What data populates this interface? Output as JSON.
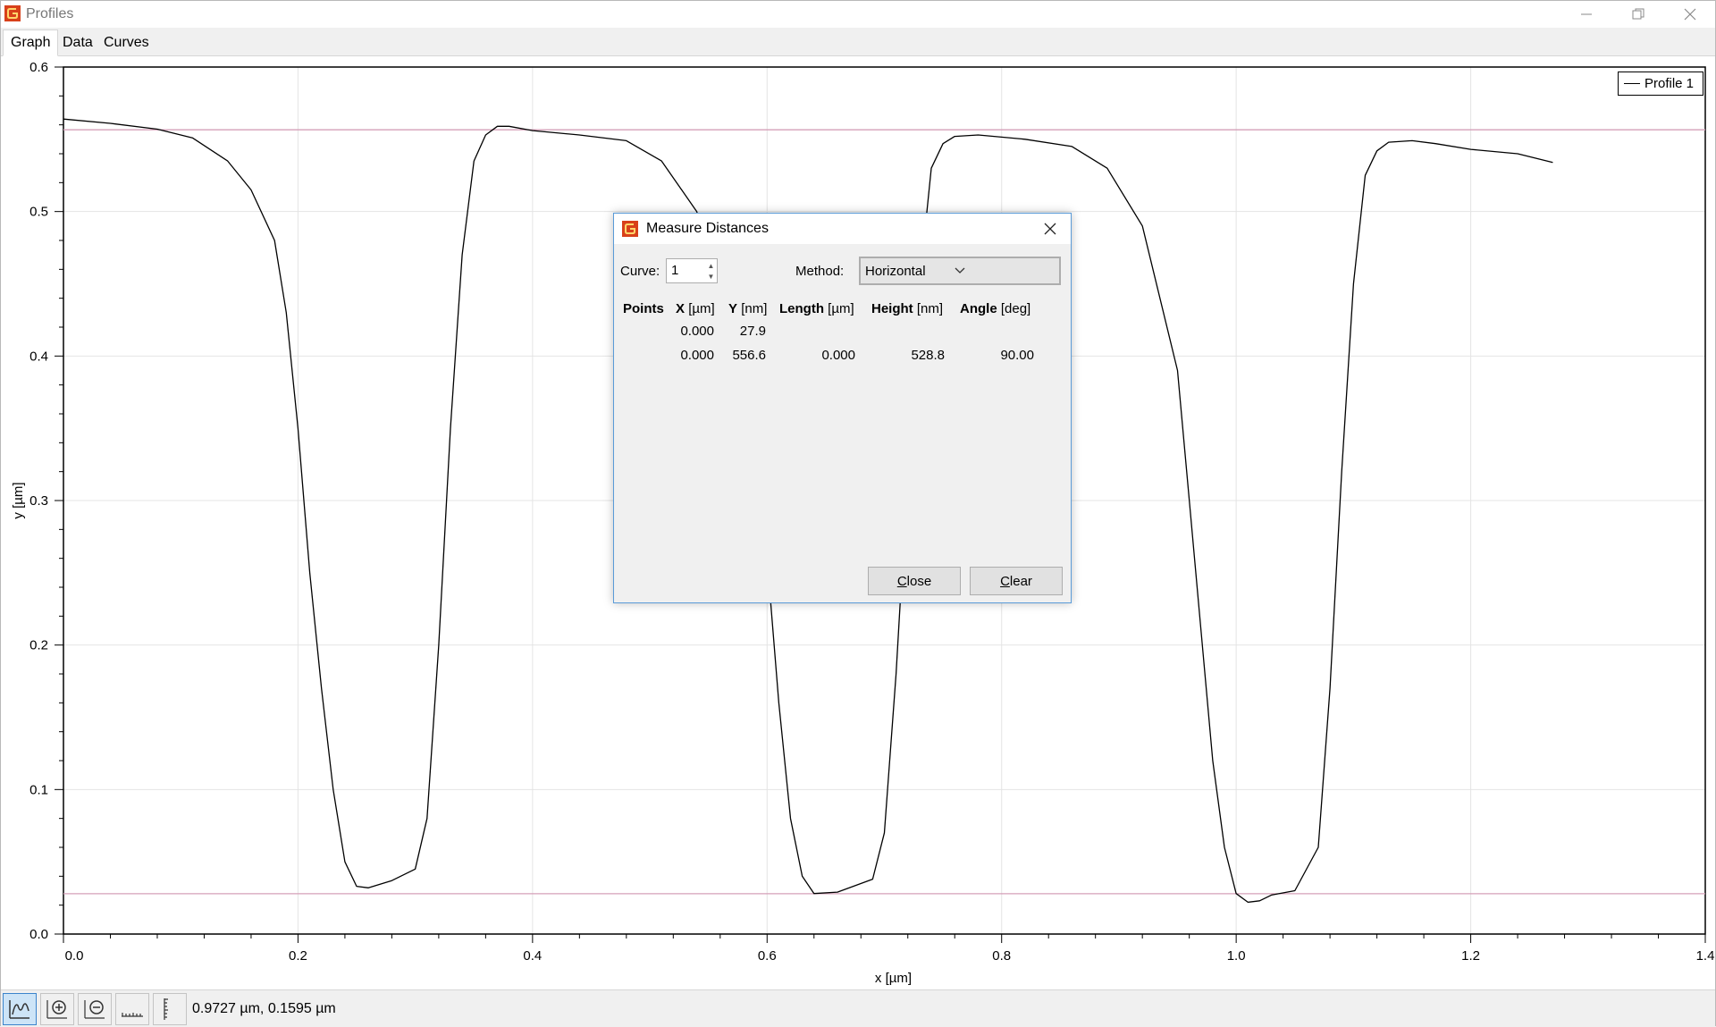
{
  "window": {
    "title": "Profiles"
  },
  "tabs": [
    {
      "label": "Graph"
    },
    {
      "label": "Data"
    },
    {
      "label": "Curves"
    }
  ],
  "legend": {
    "label": "Profile 1"
  },
  "status": {
    "coords": "0.9727 µm, 0.1595 µm"
  },
  "toolbar": {
    "tools": [
      "profile-select-icon",
      "zoom-in-icon",
      "zoom-out-icon",
      "measure-horizontal-icon",
      "measure-vertical-icon"
    ]
  },
  "dialog": {
    "title": "Measure Distances",
    "curve_label": "Curve:",
    "curve_value": "1",
    "method_label": "Method:",
    "method_value": "Horizontal",
    "headers": [
      {
        "bold": "Points",
        "unit": ""
      },
      {
        "bold": "X",
        "unit": "[µm]"
      },
      {
        "bold": "Y",
        "unit": "[nm]"
      },
      {
        "bold": "Length",
        "unit": "[µm]"
      },
      {
        "bold": "Height",
        "unit": "[nm]"
      },
      {
        "bold": "Angle",
        "unit": "[deg]"
      }
    ],
    "rows": [
      {
        "x": "0.000",
        "y": "27.9",
        "length": "",
        "height": "",
        "angle": ""
      },
      {
        "x": "0.000",
        "y": "556.6",
        "length": "0.000",
        "height": "528.8",
        "angle": "90.00"
      }
    ],
    "close_label": "Close",
    "close_mnemonic": "C",
    "close_rest": "lose",
    "clear_label": "Clear",
    "clear_mnemonic": "C",
    "clear_rest": "lear"
  },
  "colors": {
    "accent": "#3b84cc",
    "marker_line": "#d5a0b8",
    "curve": "#000000",
    "grid": "#e4e4e4"
  },
  "chart_data": {
    "type": "line",
    "xlabel": "x [µm]",
    "ylabel": "y [µm]",
    "xlim": [
      0,
      1.4
    ],
    "ylim": [
      0,
      0.6
    ],
    "xticks": [
      "0.0",
      "0.2",
      "0.4",
      "0.6",
      "0.8",
      "1.0",
      "1.2",
      "1.4"
    ],
    "yticks": [
      "0.0",
      "0.1",
      "0.2",
      "0.3",
      "0.4",
      "0.5",
      "0.6"
    ],
    "grid": true,
    "legend_position": "top-right",
    "horizontal_markers": [
      0.5566,
      0.0279
    ],
    "series": [
      {
        "name": "Profile 1",
        "x": [
          0.0,
          0.04,
          0.08,
          0.11,
          0.14,
          0.16,
          0.18,
          0.19,
          0.2,
          0.21,
          0.22,
          0.23,
          0.24,
          0.25,
          0.26,
          0.28,
          0.3,
          0.31,
          0.32,
          0.33,
          0.34,
          0.35,
          0.36,
          0.37,
          0.38,
          0.4,
          0.44,
          0.48,
          0.51,
          0.54,
          0.57,
          0.59,
          0.6,
          0.61,
          0.62,
          0.63,
          0.64,
          0.66,
          0.69,
          0.7,
          0.71,
          0.72,
          0.73,
          0.74,
          0.75,
          0.76,
          0.78,
          0.82,
          0.86,
          0.89,
          0.92,
          0.95,
          0.96,
          0.97,
          0.98,
          0.99,
          1.0,
          1.01,
          1.02,
          1.03,
          1.05,
          1.07,
          1.08,
          1.09,
          1.1,
          1.11,
          1.12,
          1.13,
          1.15,
          1.17,
          1.2,
          1.24,
          1.27
        ],
        "y": [
          0.564,
          0.561,
          0.557,
          0.551,
          0.535,
          0.515,
          0.48,
          0.43,
          0.35,
          0.25,
          0.17,
          0.1,
          0.05,
          0.033,
          0.032,
          0.037,
          0.045,
          0.08,
          0.2,
          0.35,
          0.47,
          0.535,
          0.553,
          0.559,
          0.559,
          0.556,
          0.553,
          0.549,
          0.535,
          0.5,
          0.42,
          0.33,
          0.26,
          0.16,
          0.08,
          0.04,
          0.028,
          0.029,
          0.038,
          0.07,
          0.18,
          0.32,
          0.45,
          0.53,
          0.547,
          0.552,
          0.553,
          0.55,
          0.545,
          0.53,
          0.49,
          0.39,
          0.3,
          0.21,
          0.12,
          0.06,
          0.028,
          0.022,
          0.023,
          0.027,
          0.03,
          0.06,
          0.17,
          0.32,
          0.45,
          0.525,
          0.542,
          0.548,
          0.549,
          0.547,
          0.543,
          0.54,
          0.534
        ]
      }
    ]
  }
}
